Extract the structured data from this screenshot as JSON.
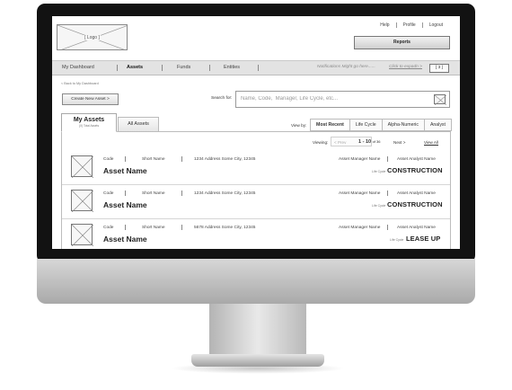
{
  "header": {
    "logo_label": "[ Logo ]",
    "links": [
      "Help",
      "Profile",
      "Logout"
    ],
    "reports_label": "Reports"
  },
  "nav": {
    "items": [
      "My Dashboard",
      "Assets",
      "Funds",
      "Entities"
    ],
    "active": "Assets",
    "notification_text": "Notifications Might go here......",
    "notification_link": "Click to expadn >",
    "notification_count": "[ 3 ]"
  },
  "page": {
    "back_link": "< Back to My Dashboard",
    "create_label": "Create New Asset >",
    "search_label": "Search for:",
    "search_placeholder": "Name, Code,  Manager, Life Cycle, etc..."
  },
  "tabs": {
    "my_assets": "My Assets",
    "my_assets_sub": "(X) Total Assets",
    "all_assets": "All Assets"
  },
  "sort": {
    "label": "View by:",
    "options": [
      "Most Recent",
      "Life Cycle",
      "Alpha-Numeric",
      "Analyst"
    ],
    "active": "Most Recent"
  },
  "pager": {
    "viewing_label": "Viewing:",
    "prev": "< Prev",
    "range_bold": "1 - 10",
    "range_rest": "of 36",
    "next": "Next >",
    "view_all": "View All"
  },
  "assets": [
    {
      "code": "Code",
      "short_name": "Short Name",
      "address": "1234 Address  Some City, 12345",
      "manager": "Asset Manager Name",
      "analyst": "Asset Analyst Name",
      "name": "Asset Name",
      "lc_label": "Life Cycle",
      "status": "CONSTRUCTION"
    },
    {
      "code": "Code",
      "short_name": "Short Name",
      "address": "1234 Address  Some City, 12345",
      "manager": "Asset Manager Name",
      "analyst": "Asset Analyst Name",
      "name": "Asset Name",
      "lc_label": "Life Cycle",
      "status": "CONSTRUCTION"
    },
    {
      "code": "Code",
      "short_name": "Short Name",
      "address": "5678 Address  Some City, 12345",
      "manager": "Asset Manager Name",
      "analyst": "Asset Analyst Name",
      "name": "Asset Name",
      "lc_label": "Life Cycle",
      "status": "LEASE UP"
    }
  ]
}
